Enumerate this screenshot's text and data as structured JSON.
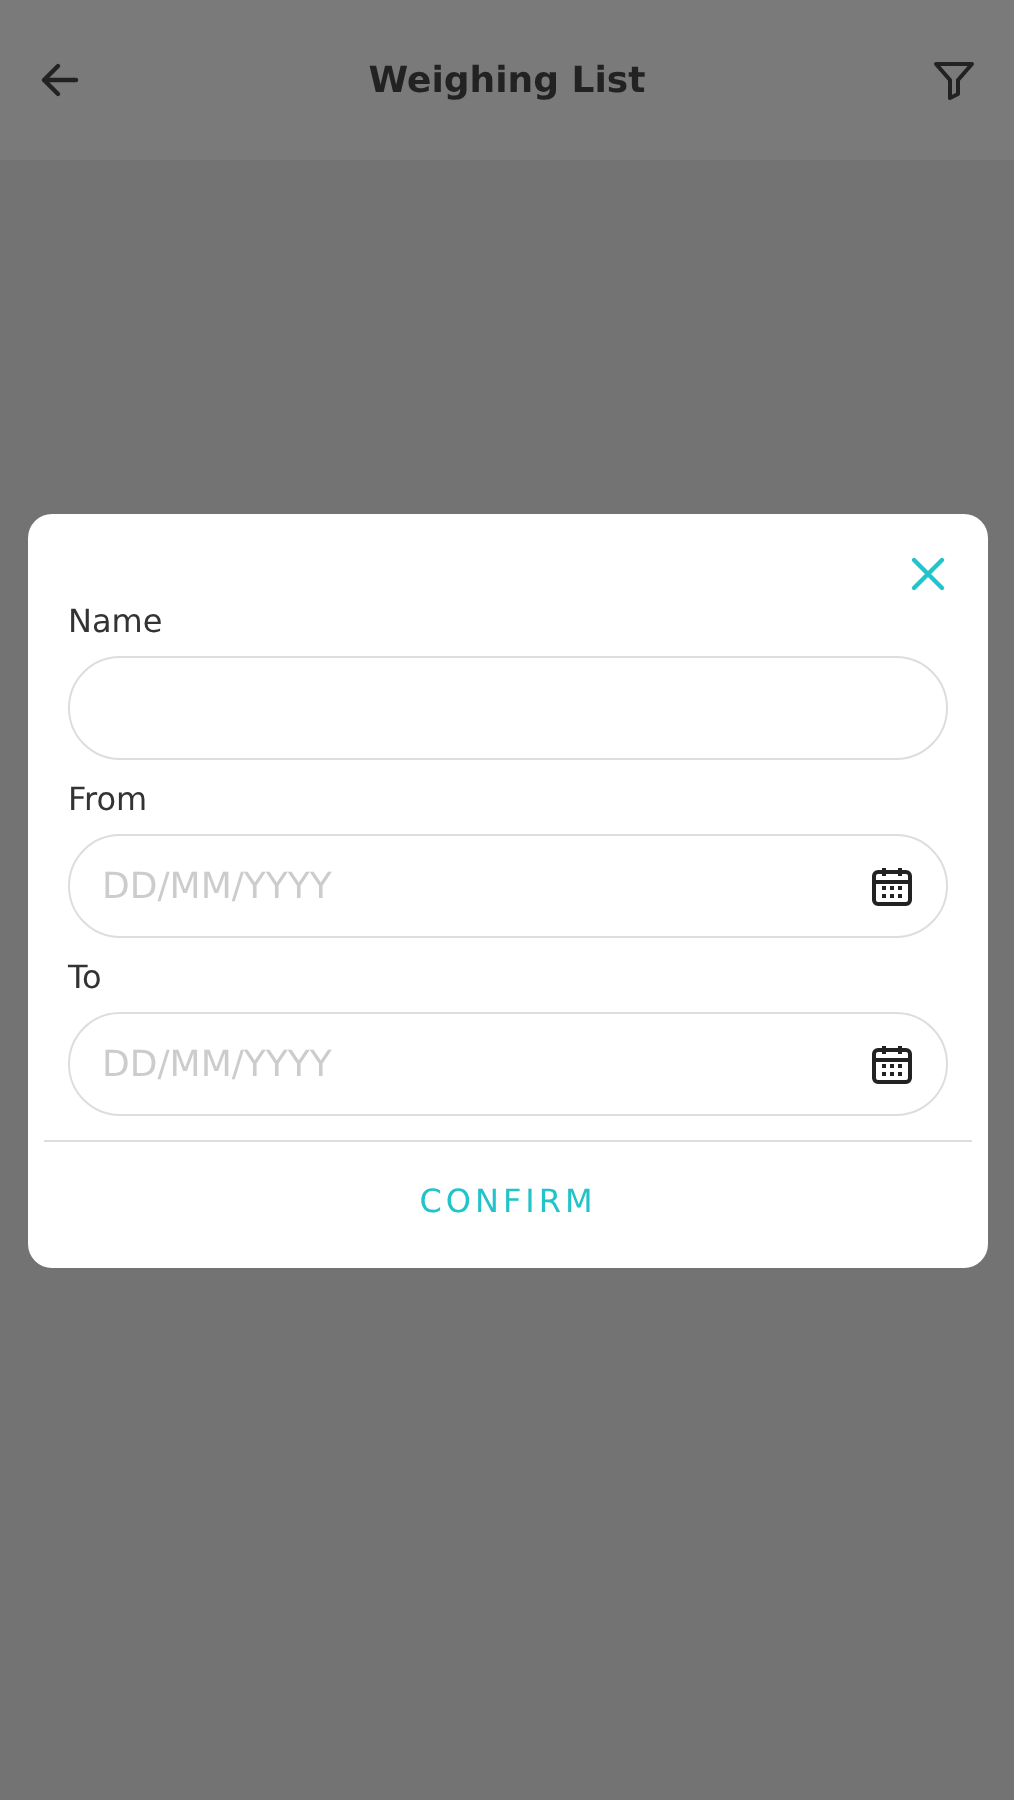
{
  "header": {
    "title": "Weighing List"
  },
  "dialog": {
    "fields": [
      {
        "kind": "text",
        "label": "Name"
      },
      {
        "kind": "date",
        "label": "From",
        "placeholder": "DD/MM/YYYY"
      },
      {
        "kind": "date",
        "label": "To",
        "placeholder": "DD/MM/YYYY"
      }
    ],
    "confirm": "CONFIRM"
  }
}
